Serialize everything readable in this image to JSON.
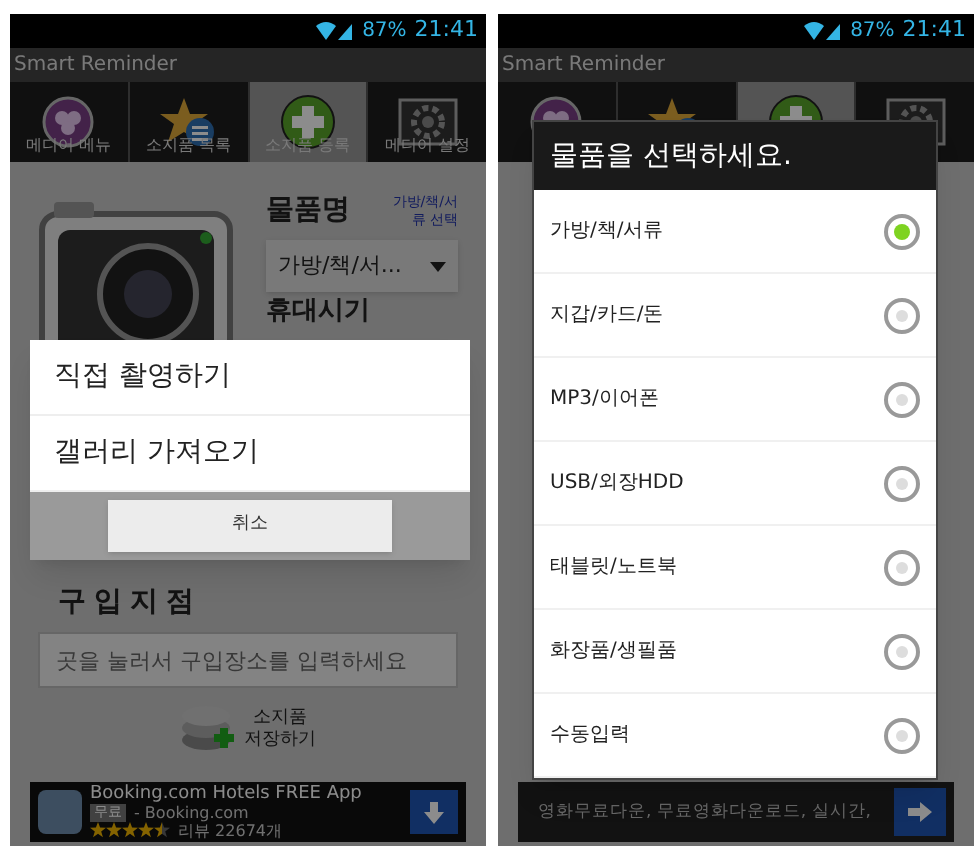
{
  "screens": [
    {
      "status_bar": {
        "battery": "87%",
        "time": "21:41"
      },
      "title": "Smart Reminder",
      "tabs": [
        {
          "label": "메디어 메뉴",
          "selected": false
        },
        {
          "label": "소지품 목록",
          "selected": false
        },
        {
          "label": "소지품 등록",
          "selected": true
        },
        {
          "label": "메디어 설정",
          "selected": false
        }
      ],
      "form": {
        "item_label": "물품명",
        "item_link": "가방/책/서류 선택",
        "item_value": "가방/책/서...",
        "carry_label": "휴대시기",
        "place_label": "구입지점",
        "place_placeholder": "곳을 눌러서 구입장소를 입력하세요",
        "save_button": "소지품 저장하기"
      },
      "dialog": {
        "kind": "action",
        "options": [
          {
            "label": "직접 촬영하기"
          },
          {
            "label": "갤러리 가져오기"
          }
        ],
        "cancel": "취소"
      },
      "ad": {
        "kind": "app",
        "title": "Booking.com Hotels FREE App",
        "badge": "무료",
        "publisher": "- Booking.com",
        "stars": 4.5,
        "reviews": "리뷰 22674개"
      }
    },
    {
      "status_bar": {
        "battery": "87%",
        "time": "21:41"
      },
      "title": "Smart Reminder",
      "tabs": [
        {
          "selected": false
        },
        {
          "selected": false
        },
        {
          "selected": true
        },
        {
          "selected": false
        }
      ],
      "dialog": {
        "kind": "choice",
        "title": "물품을 선택하세요.",
        "options": [
          {
            "label": "가방/책/서류",
            "selected": true
          },
          {
            "label": "지갑/카드/돈",
            "selected": false
          },
          {
            "label": "MP3/이어폰",
            "selected": false
          },
          {
            "label": "USB/외장HDD",
            "selected": false
          },
          {
            "label": "태블릿/노트북",
            "selected": false
          },
          {
            "label": "화장품/생필품",
            "selected": false
          },
          {
            "label": "수동입력",
            "selected": false
          }
        ]
      },
      "ad": {
        "kind": "text",
        "text": "영화무료다운, 무료영화다운로드, 실시간,"
      }
    }
  ]
}
